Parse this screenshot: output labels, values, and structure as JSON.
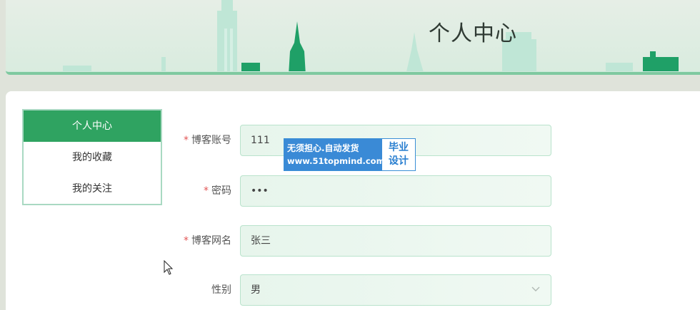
{
  "header": {
    "title": "个人中心"
  },
  "sidebar": {
    "items": [
      {
        "label": "个人中心",
        "active": true
      },
      {
        "label": "我的收藏",
        "active": false
      },
      {
        "label": "我的关注",
        "active": false
      }
    ]
  },
  "form": {
    "account": {
      "label": "博客账号",
      "required": true,
      "value": "111"
    },
    "password": {
      "label": "密码",
      "required": true,
      "value": "•••"
    },
    "nickname": {
      "label": "博客网名",
      "required": true,
      "value": "张三"
    },
    "gender": {
      "label": "性别",
      "required": false,
      "value": "男"
    }
  },
  "watermark": {
    "slogan": "无须担心.自动发货",
    "url": "www.51topmind.com",
    "tag_line1": "毕业",
    "tag_line2": "设计"
  },
  "colors": {
    "accent": "#2fa361",
    "required": "#e25555",
    "input_border": "#b9e3cc"
  }
}
